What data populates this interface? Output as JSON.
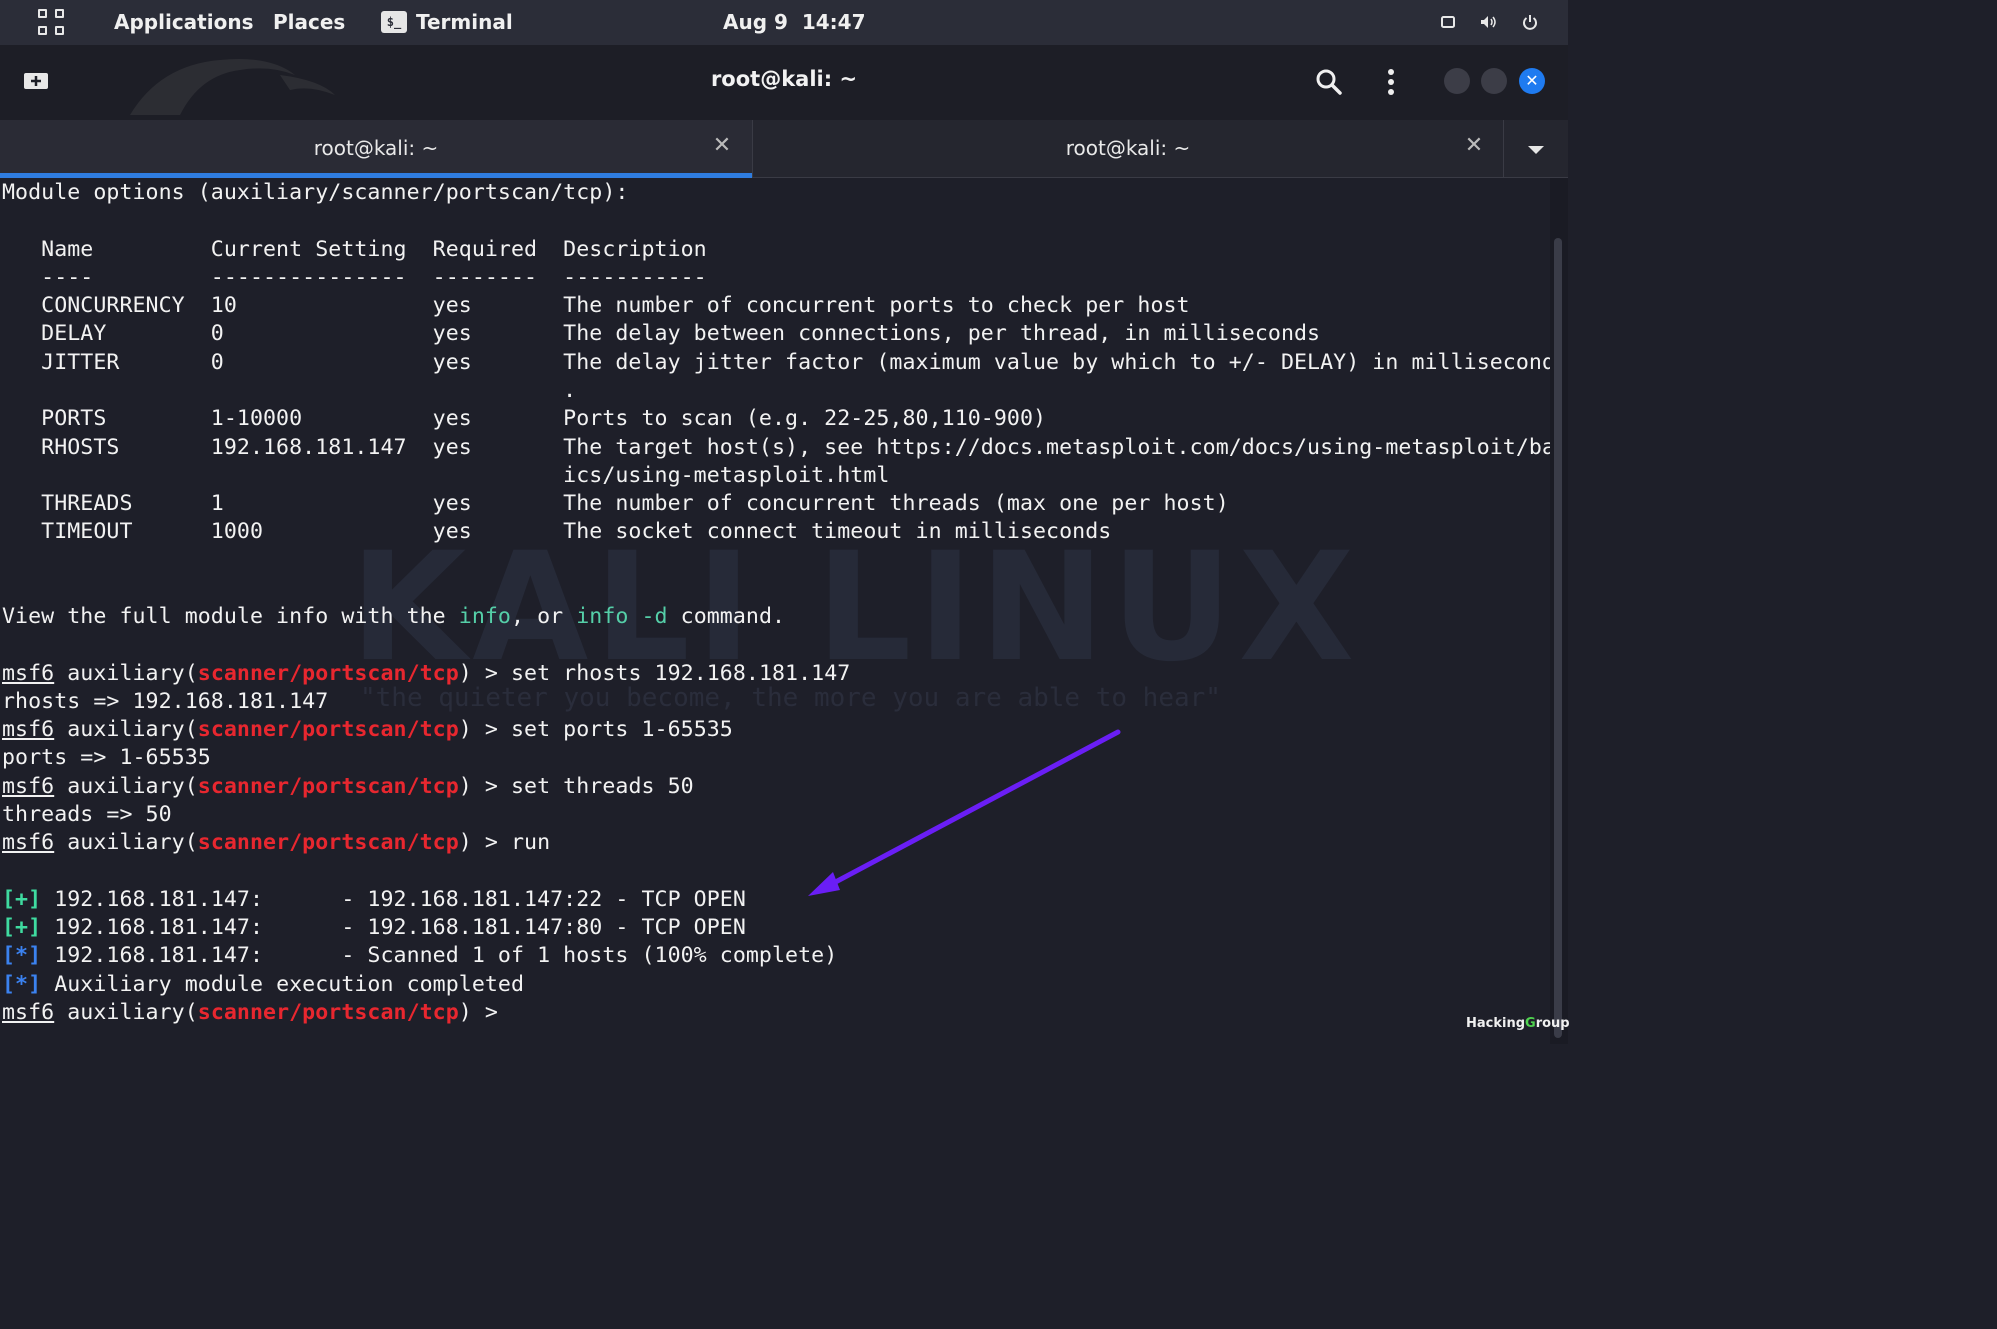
{
  "topbar": {
    "apps_grid_icon": "apps-grid-icon",
    "applications": "Applications",
    "places": "Places",
    "terminal_badge": "$_",
    "terminal": "Terminal",
    "clock": "Aug 9  14:47",
    "icons": [
      "display-icon",
      "volume-icon",
      "power-icon"
    ]
  },
  "window": {
    "title": "root@kali: ~",
    "icons": [
      "new-tab-icon",
      "search-icon",
      "kebab-menu-icon",
      "close-icon"
    ]
  },
  "tabs": [
    {
      "label": "root@kali: ~",
      "active": true
    },
    {
      "label": "root@kali: ~",
      "active": false
    }
  ],
  "terminal": {
    "watermark": "KALI LINUX",
    "motto": "\"the quieter you become, the more you are able to hear\"",
    "header": "Module options (auxiliary/scanner/portscan/tcp):",
    "table_header": "   Name         Current Setting  Required  Description",
    "table_rule": "   ----         ---------------  --------  -----------",
    "rows": [
      "   CONCURRENCY  10               yes       The number of concurrent ports to check per host",
      "   DELAY        0                yes       The delay between connections, per thread, in milliseconds",
      "   JITTER       0                yes       The delay jitter factor (maximum value by which to +/- DELAY) in milliseconds",
      "                                           .",
      "   PORTS        1-10000          yes       Ports to scan (e.g. 22-25,80,110-900)",
      "   RHOSTS       192.168.181.147  yes       The target host(s), see https://docs.metasploit.com/docs/using-metasploit/bas",
      "                                           ics/using-metasploit.html",
      "   THREADS      1                yes       The number of concurrent threads (max one per host)",
      "   TIMEOUT      1000             yes       The socket connect timeout in milliseconds"
    ],
    "info_line": {
      "pre": "View the full module info with the ",
      "info": "info",
      "mid": ", or ",
      "info_d": "info -d",
      "post": " command."
    },
    "prompt": {
      "msf": "msf6",
      "pre": " auxiliary(",
      "module": "scanner/portscan/tcp",
      "post": ") > "
    },
    "commands": [
      {
        "cmd": "set rhosts 192.168.181.147",
        "out": "rhosts => 192.168.181.147"
      },
      {
        "cmd": "set ports 1-65535",
        "out": "ports => 1-65535"
      },
      {
        "cmd": "set threads 50",
        "out": "threads => 50"
      },
      {
        "cmd": "run",
        "out": ""
      }
    ],
    "results": [
      {
        "tag": "[+]",
        "text": " 192.168.181.147:      - 192.168.181.147:22 - TCP OPEN"
      },
      {
        "tag": "[+]",
        "text": " 192.168.181.147:      - 192.168.181.147:80 - TCP OPEN"
      },
      {
        "tag": "[*]",
        "text": " 192.168.181.147:      - Scanned 1 of 1 hosts (100% complete)"
      },
      {
        "tag": "[*]",
        "text": " Auxiliary module execution completed"
      }
    ]
  },
  "brand": {
    "pre": "Hacking",
    "accent": "G",
    "post": "roup"
  },
  "colors": {
    "accent_tab": "#2f7de0",
    "prompt_module": "#e8272f",
    "info_cmd": "#55cfa8",
    "plus_tag": "#3fdba0",
    "star_tag": "#3b82f0",
    "arrow": "#6a1ef5"
  }
}
